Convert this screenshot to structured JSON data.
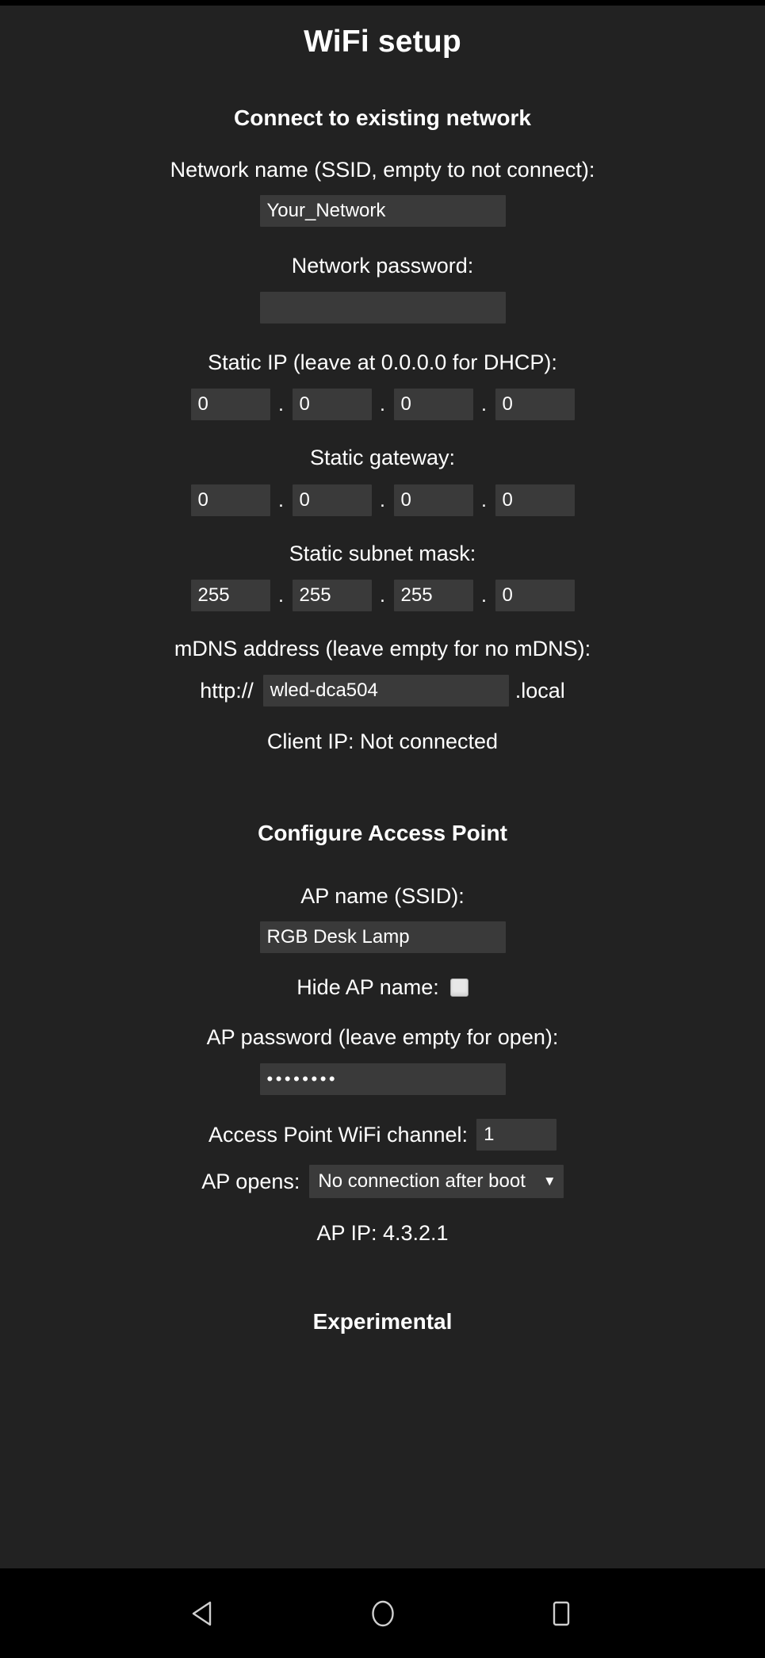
{
  "page": {
    "title": "WiFi setup",
    "sections": {
      "connect": "Connect to existing network",
      "ap": "Configure Access Point",
      "experimental": "Experimental"
    }
  },
  "connect": {
    "ssid_label": "Network name (SSID, empty to not connect):",
    "ssid_value": "Your_Network",
    "password_label": "Network password:",
    "password_value": "",
    "static_ip_label": "Static IP (leave at 0.0.0.0 for DHCP):",
    "static_ip": [
      "0",
      "0",
      "0",
      "0"
    ],
    "gateway_label": "Static gateway:",
    "gateway": [
      "0",
      "0",
      "0",
      "0"
    ],
    "subnet_label": "Static subnet mask:",
    "subnet": [
      "255",
      "255",
      "255",
      "0"
    ],
    "mdns_label": "mDNS address (leave empty for no mDNS):",
    "mdns_prefix": "http://",
    "mdns_value": "wled-dca504",
    "mdns_suffix": ".local",
    "client_ip": "Client IP: Not connected",
    "separator": "."
  },
  "accesspoint": {
    "ap_name_label": "AP name (SSID):",
    "ap_name_value": "RGB Desk Lamp",
    "hide_ap_label": "Hide AP name:",
    "hide_ap_checked": false,
    "ap_password_label": "AP password (leave empty for open):",
    "ap_password_value": "••••••••",
    "channel_label": "Access Point WiFi channel:",
    "channel_value": "1",
    "ap_opens_label": "AP opens:",
    "ap_opens_value": "No connection after boot",
    "ap_opens_caret": "▼",
    "ap_ip": "AP IP: 4.3.2.1"
  },
  "navbar": {
    "back": "back-triangle-icon",
    "home": "home-circle-icon",
    "recents": "recents-square-icon"
  },
  "colors": {
    "page_bg": "#222222",
    "field_bg": "#3a3a3a",
    "text": "#ffffff",
    "navbar_bg": "#000000"
  }
}
